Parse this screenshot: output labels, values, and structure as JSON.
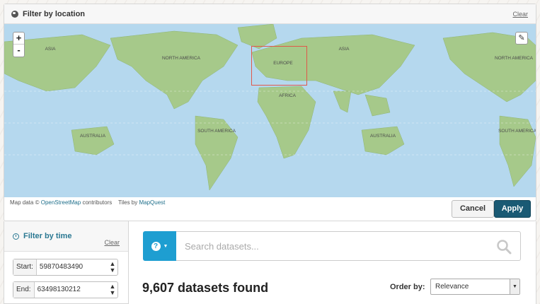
{
  "location_filter": {
    "title": "Filter by location",
    "clear_label": "Clear",
    "zoom_in": "+",
    "zoom_out": "-",
    "edit_icon": "pencil-icon",
    "map_labels": {
      "north_america": "NORTH AMERICA",
      "europe": "EUROPE",
      "africa": "AFRICA",
      "asia": "ASIA",
      "south_america": "SOUTH AMERICA",
      "australia": "AUSTRALIA"
    },
    "attribution": {
      "prefix": "Map data ©",
      "osm": "OpenStreetMap",
      "contributors": "contributors",
      "tiles_prefix": "Tiles by",
      "tiles": "MapQuest"
    },
    "cancel_label": "Cancel",
    "apply_label": "Apply"
  },
  "time_filter": {
    "title": "Filter by time",
    "clear_label": "Clear",
    "start_label": "Start:",
    "start_value": "59870483490",
    "end_label": "End:",
    "end_value": "63498130212"
  },
  "search": {
    "help_icon": "question-icon",
    "placeholder": "Search datasets...",
    "search_icon": "magnifier-icon"
  },
  "results": {
    "count_text": "9,607 datasets found",
    "order_label": "Order by:",
    "order_value": "Relevance"
  },
  "colors": {
    "apply": "#1a5a74",
    "help": "#1e9ed1",
    "ocean": "#b5d8ee",
    "land": "#9cc37a",
    "bbox": "#e0584a"
  }
}
